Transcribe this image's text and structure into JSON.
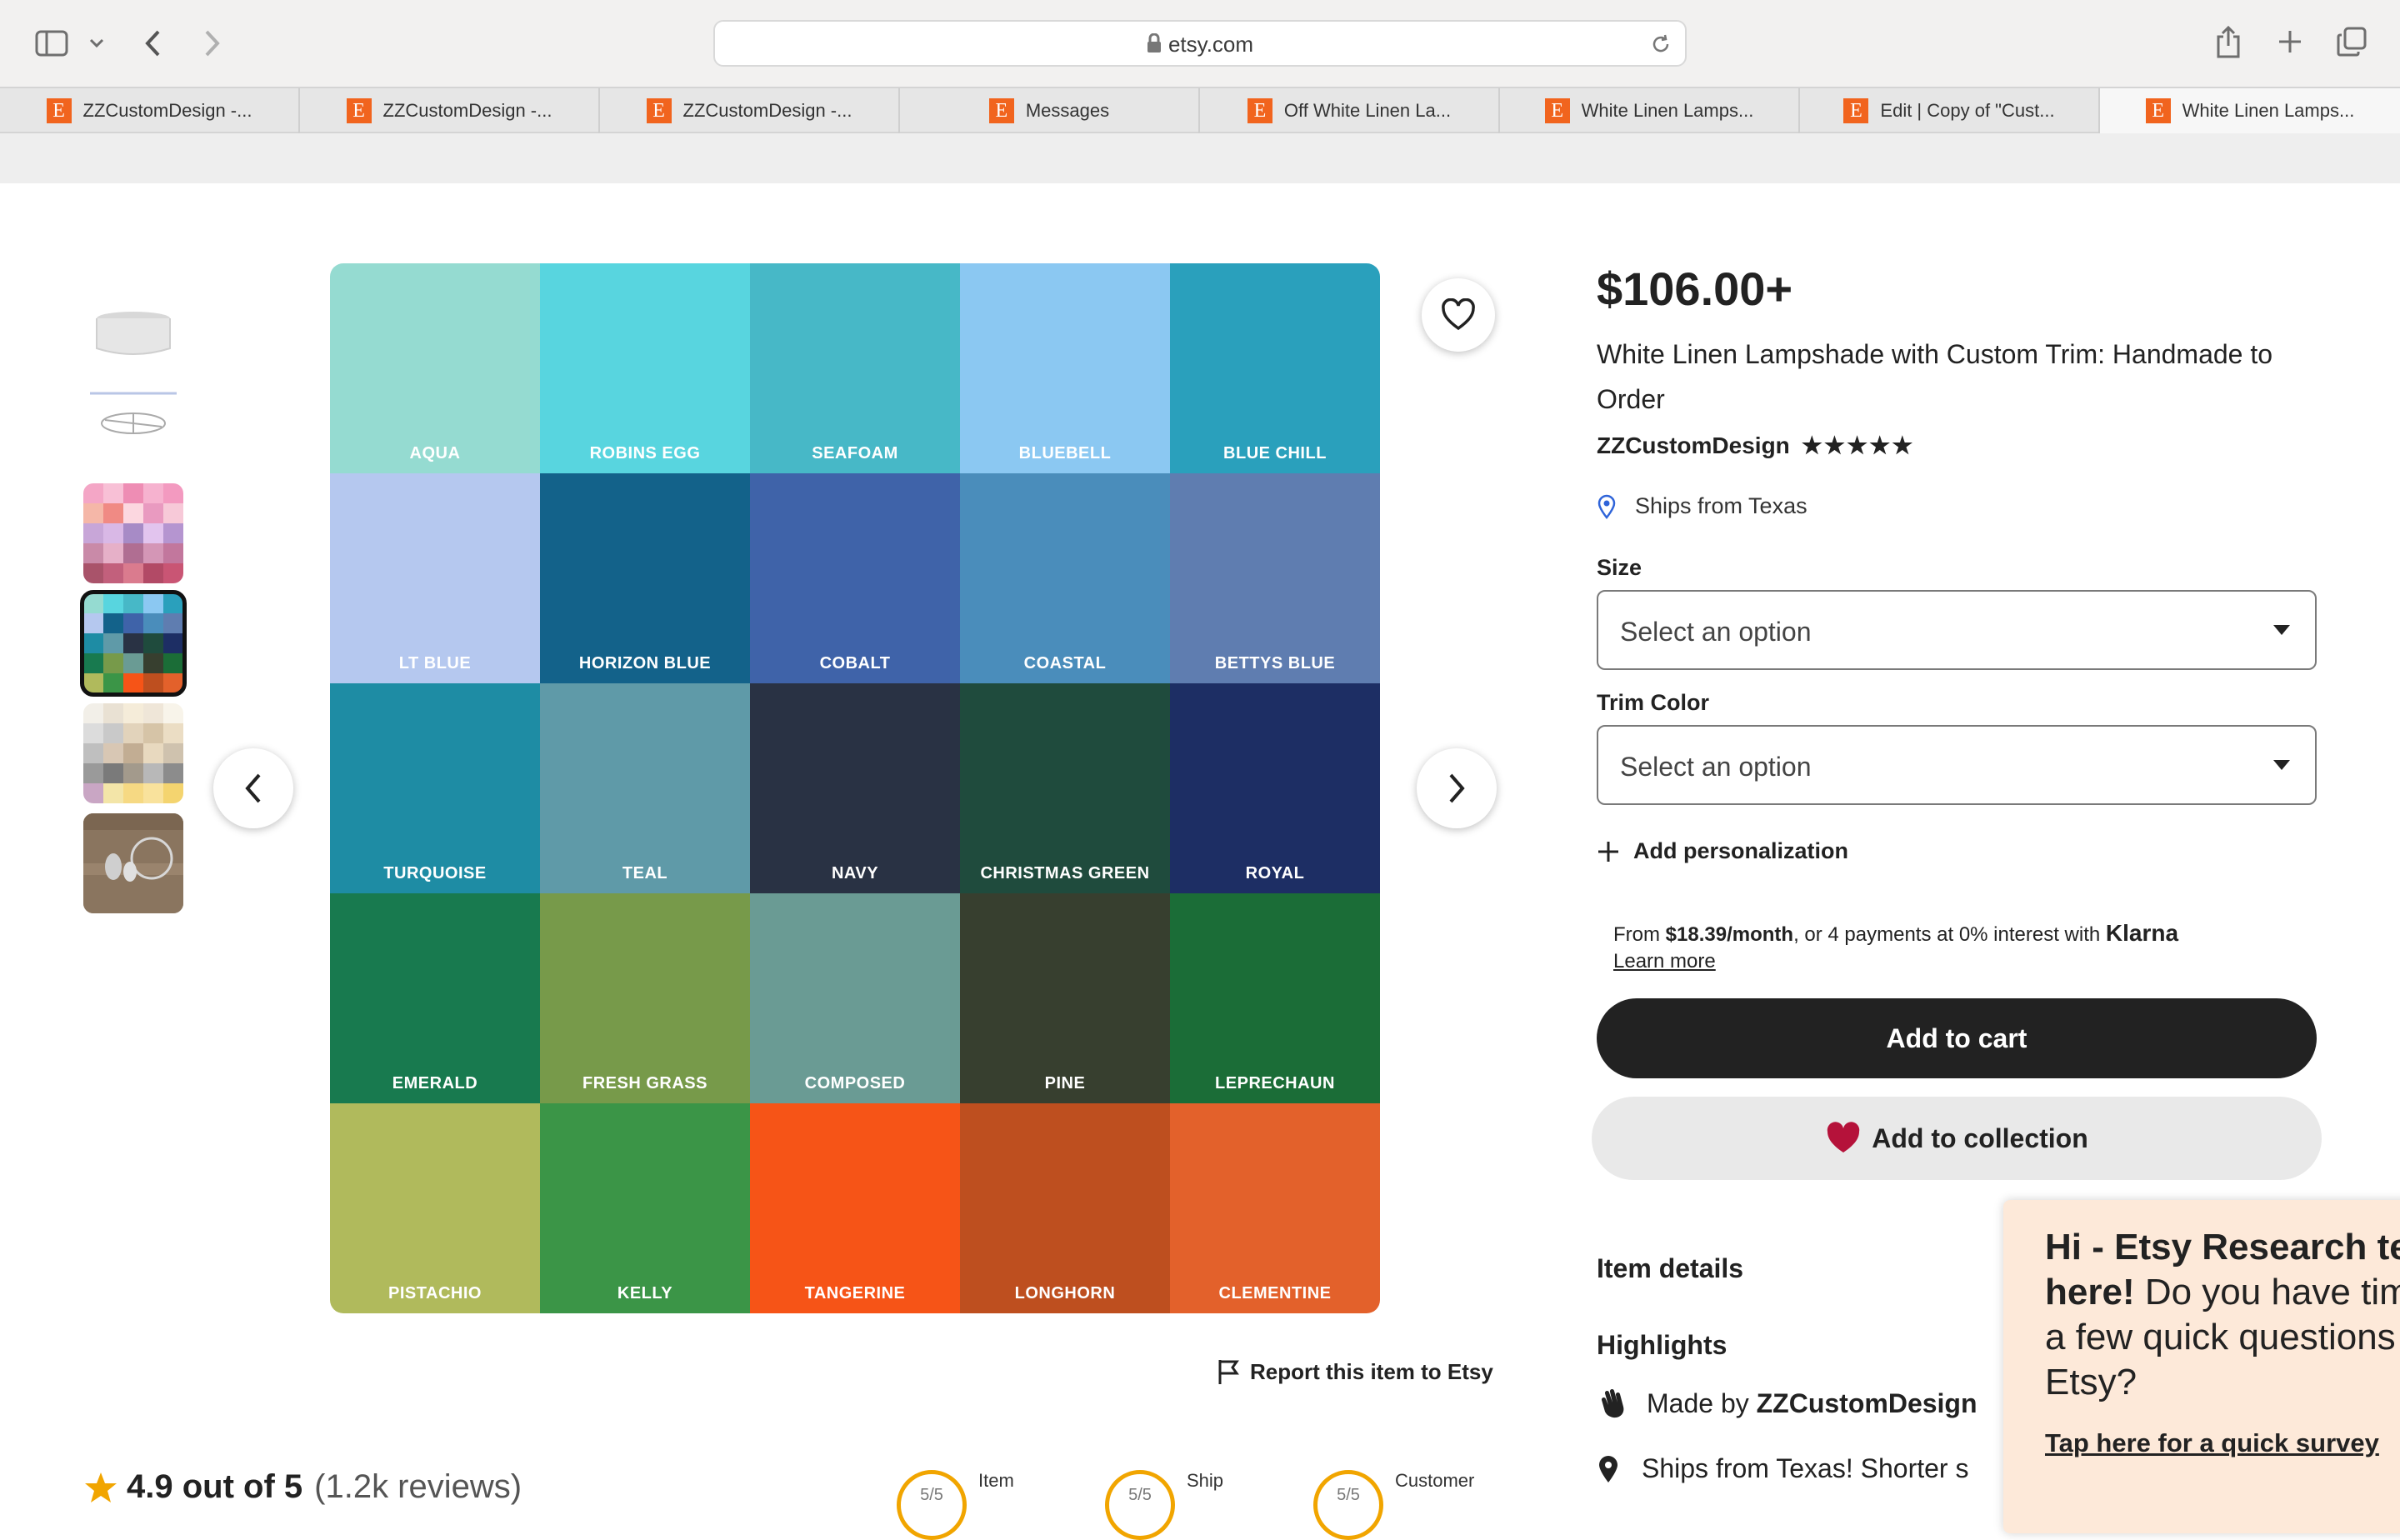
{
  "browser": {
    "url": "etsy.com",
    "tabs": [
      {
        "label": "ZZCustomDesign -..."
      },
      {
        "label": "ZZCustomDesign -..."
      },
      {
        "label": "ZZCustomDesign -..."
      },
      {
        "label": "Messages"
      },
      {
        "label": "Off White Linen La..."
      },
      {
        "label": "White Linen Lamps..."
      },
      {
        "label": "Edit | Copy of \"Cust..."
      },
      {
        "label": "White Linen Lamps..."
      }
    ],
    "favicon_letter": "E"
  },
  "swatches": [
    {
      "label": "AQUA",
      "color": "#95dbd1"
    },
    {
      "label": "ROBINS EGG",
      "color": "#58d5df"
    },
    {
      "label": "SEAFOAM",
      "color": "#47b8c7"
    },
    {
      "label": "BLUEBELL",
      "color": "#8bc8f2"
    },
    {
      "label": "BLUE CHILL",
      "color": "#2aa0bc"
    },
    {
      "label": "LT BLUE",
      "color": "#b5c8ef"
    },
    {
      "label": "HORIZON BLUE",
      "color": "#13628a"
    },
    {
      "label": "COBALT",
      "color": "#3f63a9"
    },
    {
      "label": "COASTAL",
      "color": "#4a8dbb"
    },
    {
      "label": "BETTYS BLUE",
      "color": "#5f7db0"
    },
    {
      "label": "TURQUOISE",
      "color": "#1e8ca4"
    },
    {
      "label": "TEAL",
      "color": "#5f9aa8"
    },
    {
      "label": "NAVY",
      "color": "#293244"
    },
    {
      "label": "CHRISTMAS GREEN",
      "color": "#1f4b3d"
    },
    {
      "label": "ROYAL",
      "color": "#1d2e64"
    },
    {
      "label": "EMERALD",
      "color": "#187a4f"
    },
    {
      "label": "FRESH GRASS",
      "color": "#779a4a"
    },
    {
      "label": "COMPOSED",
      "color": "#6a9b94"
    },
    {
      "label": "PINE",
      "color": "#373f2f"
    },
    {
      "label": "LEPRECHAUN",
      "color": "#1b6d37"
    },
    {
      "label": "PISTACHIO",
      "color": "#b0ba5c"
    },
    {
      "label": "KELLY",
      "color": "#3b9547"
    },
    {
      "label": "TANGERINE",
      "color": "#f65417"
    },
    {
      "label": "LONGHORN",
      "color": "#be4f1f"
    },
    {
      "label": "CLEMENTINE",
      "color": "#e3612b"
    }
  ],
  "product": {
    "price": "$106.00+",
    "title": "White Linen Lampshade with Custom Trim: Handmade to Order",
    "shop_name": "ZZCustomDesign",
    "stars": "★★★★★",
    "ships_from": "Ships from Texas",
    "size_label": "Size",
    "size_value": "Select an option",
    "trim_label": "Trim Color",
    "trim_value": "Select an option",
    "add_personalization": "Add personalization",
    "klarna_prefix": "From ",
    "klarna_amount": "$18.39/month",
    "klarna_suffix": ", or 4 payments at 0% interest with ",
    "klarna_brand": "Klarna",
    "klarna_learn": "Learn more",
    "add_to_cart": "Add to cart",
    "add_to_collection": "Add to collection",
    "item_details": "Item details",
    "highlights": "Highlights",
    "made_by_prefix": "Made by ",
    "made_by_shop": "ZZCustomDesign",
    "ships_highlight": "Ships from Texas! Shorter s"
  },
  "report": "Report this item to Etsy",
  "reviews": {
    "score": "4.9 out of 5",
    "count": "(1.2k reviews)",
    "stats": [
      {
        "value": "5/5",
        "label": "Item"
      },
      {
        "value": "5/5",
        "label": "Ship"
      },
      {
        "value": "5/5",
        "label": "Customer"
      }
    ]
  },
  "survey": {
    "bold1": "Hi - Etsy Research te",
    "bold2": "here!",
    "rest1": " Do you have tim",
    "line3": "a few quick questions",
    "line4": "Etsy?",
    "link": "Tap here for a quick survey"
  },
  "colors": {
    "etsy_orange": "#f1641e",
    "cart_dark": "#222222",
    "heart_red": "#b5123a",
    "survey_bg": "#fde9d9"
  }
}
